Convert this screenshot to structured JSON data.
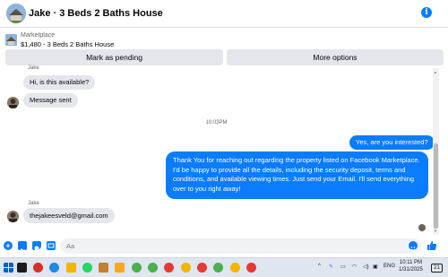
{
  "header": {
    "title": "Jake · 3 Beds 2 Baths House",
    "info_icon": "info-icon"
  },
  "listing": {
    "label": "Marketplace",
    "price_title": "$1,480 - 3 Beds 2 Baths House",
    "actions": [
      "Mark as pending",
      "More options"
    ]
  },
  "messages": {
    "top_sender": "Jake",
    "incoming_1": "Hi, is this available?",
    "incoming_2": "Message sent",
    "timestamp": "10:03PM",
    "outgoing_1": "Yes, are you interested?",
    "outgoing_2": "Thank You for reaching out regarding the property listed on Facebook Marketplace. I'd be happy to provide all the details, including the security deposit, terms and conditions, and available viewing times. Just send your Email. I'll send everything over to you right away!",
    "bottom_sender": "Jake",
    "incoming_3": "thejakeesveld@gmail.com"
  },
  "composer": {
    "placeholder": "Aa",
    "icons": [
      "plus-icon",
      "photo-icon",
      "sticker-icon",
      "gif-icon",
      "emoji-icon",
      "like-icon"
    ]
  },
  "taskbar": {
    "language": "ENG",
    "time": "10:11 PM",
    "date": "1/31/2025",
    "notifications": "21",
    "accent": "#0a7cff"
  }
}
